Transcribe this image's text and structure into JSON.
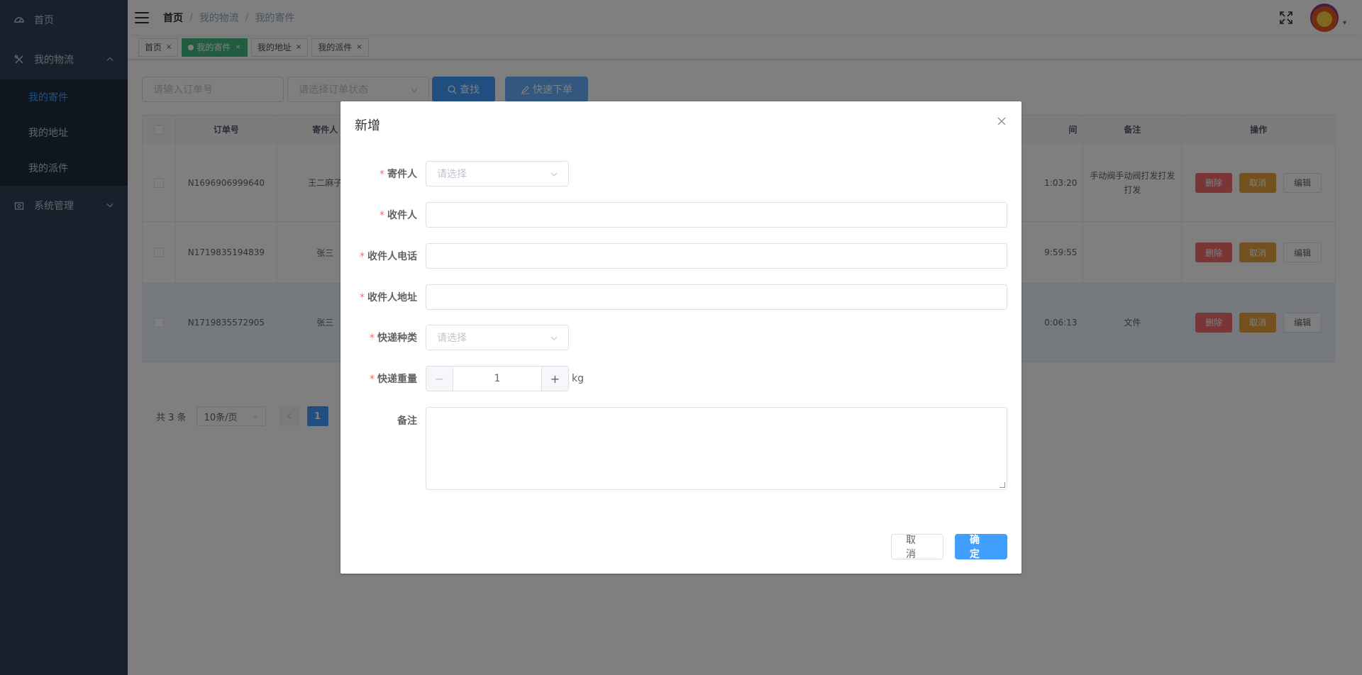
{
  "sidebar": {
    "items": [
      {
        "label": "首页",
        "icon": "dashboard-icon"
      },
      {
        "label": "我的物流",
        "icon": "tools-icon",
        "expanded": true,
        "children": [
          {
            "label": "我的寄件",
            "active": true
          },
          {
            "label": "我的地址"
          },
          {
            "label": "我的派件"
          }
        ]
      },
      {
        "label": "系统管理",
        "icon": "system-icon",
        "expanded": false
      }
    ]
  },
  "navbar": {
    "breadcrumb": [
      "首页",
      "我的物流",
      "我的寄件"
    ],
    "breadcrumb_sep": "/"
  },
  "tags": [
    {
      "label": "首页",
      "active": false
    },
    {
      "label": "我的寄件",
      "active": true
    },
    {
      "label": "我的地址",
      "active": false
    },
    {
      "label": "我的派件",
      "active": false
    }
  ],
  "toolbar": {
    "order_placeholder": "请输入订单号",
    "status_placeholder": "请选择订单状态",
    "search_label": "查找",
    "quick_order_label": "快速下单"
  },
  "table": {
    "headers": [
      "订单号",
      "寄件人",
      "间",
      "备注",
      "操作"
    ],
    "rows": [
      {
        "order_no": "N1696906999640",
        "sender": "王二麻子",
        "time": "1:03:20",
        "remark": "手动阀手动阀打发打发打发"
      },
      {
        "order_no": "N1719835194839",
        "sender": "张三",
        "time": "9:59:55",
        "remark": ""
      },
      {
        "order_no": "N1719835572905",
        "sender": "张三",
        "time": "0:06:13",
        "remark": "文件"
      }
    ],
    "actions": {
      "delete": "删除",
      "cancel": "取消",
      "edit": "编辑"
    }
  },
  "pager": {
    "total": "共 3 条",
    "page_size": "10条/页",
    "current": "1"
  },
  "dialog": {
    "title": "新增",
    "fields": {
      "sender": {
        "label": "寄件人",
        "placeholder": "请选择"
      },
      "receiver": {
        "label": "收件人"
      },
      "receiver_phone": {
        "label": "收件人电话"
      },
      "receiver_address": {
        "label": "收件人地址"
      },
      "express_type": {
        "label": "快递种类",
        "placeholder": "请选择"
      },
      "weight": {
        "label": "快递重量",
        "value": "1",
        "unit": "kg"
      },
      "remark": {
        "label": "备注"
      }
    },
    "required_mark": "*",
    "cancel_label": "取 消",
    "ok_label": "确 定"
  },
  "colors": {
    "sidebar_bg": "#304156",
    "primary": "#409eff",
    "tag_active": "#42b983",
    "danger": "#f56c6c",
    "warning": "#e6a23c"
  }
}
